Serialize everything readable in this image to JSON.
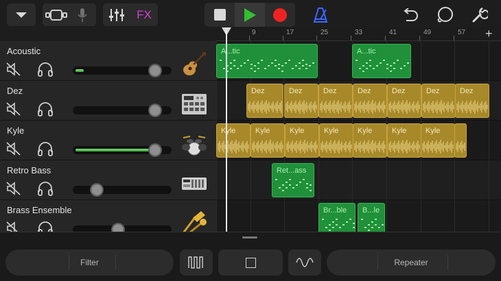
{
  "toolbar": {
    "fx_label": "FX",
    "accent": "#d63fd6",
    "play_color": "#30c030",
    "record_color": "#ee2222",
    "metronome_color": "#3a68ff"
  },
  "ruler": {
    "bars": [
      "9",
      "17",
      "25",
      "33",
      "41",
      "49",
      "57"
    ],
    "add_label": "+"
  },
  "tracks": [
    {
      "name": "Acoustic",
      "instrument_icon": "acoustic-guitar-icon",
      "volume": 0.89,
      "level": 0.1,
      "regions": [
        {
          "label": "A...tic",
          "color": "green"
        },
        {
          "label": "A...tic",
          "color": "green"
        }
      ]
    },
    {
      "name": "Dez",
      "instrument_icon": "drum-machine-icon",
      "volume": 0.89,
      "level": 0,
      "regions": [
        {
          "label": "Dez"
        },
        {
          "label": "Dez"
        },
        {
          "label": "Dez"
        },
        {
          "label": "Dez"
        },
        {
          "label": "Dez"
        },
        {
          "label": "Dez"
        },
        {
          "label": "Dez"
        }
      ]
    },
    {
      "name": "Kyle",
      "instrument_icon": "drum-kit-icon",
      "volume": 0.89,
      "level": 0.9,
      "regions": [
        {
          "label": "Kyle"
        },
        {
          "label": "Kyle"
        },
        {
          "label": "Kyle"
        },
        {
          "label": "Kyle"
        },
        {
          "label": "Kyle"
        },
        {
          "label": "Kyle"
        },
        {
          "label": "Kyle"
        }
      ]
    },
    {
      "name": "Retro Bass",
      "instrument_icon": "synth-module-icon",
      "volume": 0.2,
      "level": 0,
      "regions": [
        {
          "label": "Ret...ass"
        }
      ]
    },
    {
      "name": "Brass Ensemble",
      "instrument_icon": "brass-horns-icon",
      "volume": 0.45,
      "level": 0,
      "regions": [
        {
          "label": "Br...ble"
        },
        {
          "label": "B...le"
        }
      ]
    }
  ],
  "bottom": {
    "left_pill_label": "Filter",
    "right_pill_label": "Repeater"
  }
}
